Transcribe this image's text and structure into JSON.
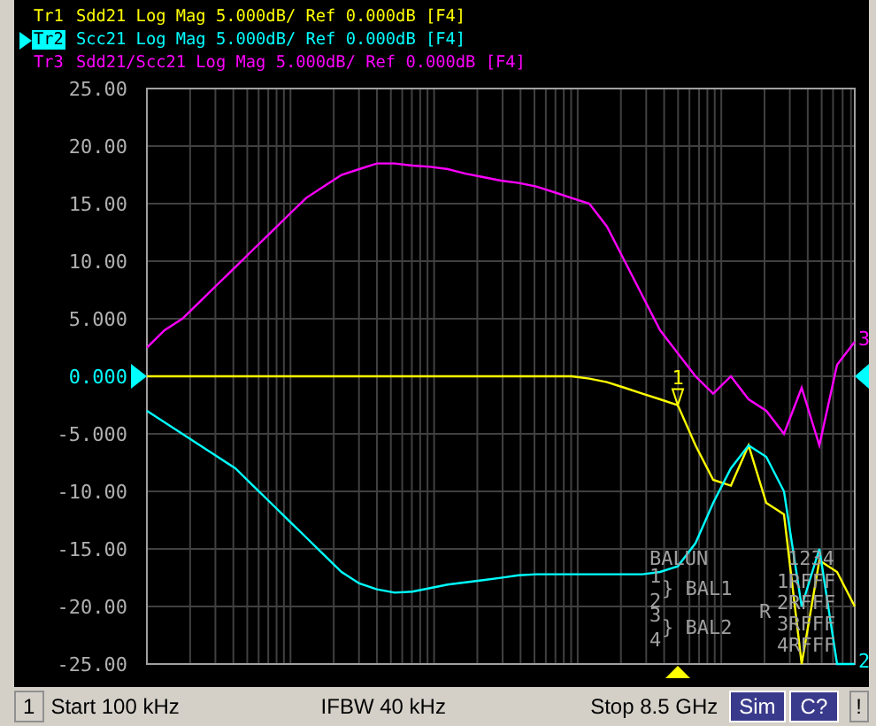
{
  "traces": [
    {
      "text": "Sdd21 Log Mag 5.000dB/ Ref 0.000dB [F4]",
      "selected": false
    },
    {
      "text": "Scc21 Log Mag 5.000dB/ Ref 0.000dB [F4]",
      "selected": true
    },
    {
      "text": "Sdd21/Scc21 Log Mag 5.000dB/ Ref 0.000dB [F4]",
      "selected": false
    }
  ],
  "chart_data": {
    "type": "line",
    "ylim": [
      -25,
      25
    ],
    "categories": [
      null,
      null,
      null,
      null,
      null,
      null,
      null,
      null,
      null,
      null,
      null,
      null,
      null,
      null,
      null,
      null,
      null,
      null,
      null,
      null,
      null,
      null,
      null,
      null,
      null,
      null,
      null,
      null,
      null,
      null,
      null,
      null,
      null,
      null,
      null,
      null,
      null,
      null,
      null,
      null,
      null
    ],
    "yticks": [
      {
        "value": 25,
        "label": "25.00"
      },
      {
        "value": 20,
        "label": "20.00"
      },
      {
        "value": 15,
        "label": "15.00"
      },
      {
        "value": 10,
        "label": "10.00"
      },
      {
        "value": 5,
        "label": "5.000"
      },
      {
        "value": 0,
        "label": "0.000"
      },
      {
        "value": -5,
        "label": "-5.000"
      },
      {
        "value": -10,
        "label": "-10.00"
      },
      {
        "value": -15,
        "label": "-15.00"
      },
      {
        "value": -20,
        "label": "-20.00"
      },
      {
        "value": -25,
        "label": "-25.00"
      }
    ],
    "series": [
      {
        "name": "Tr1",
        "color": "#ffff00",
        "values": [
          0,
          0,
          0,
          0,
          0,
          0,
          0,
          0,
          0,
          0,
          0,
          0,
          0,
          0,
          0,
          0,
          0,
          0,
          0,
          0,
          0,
          0,
          0,
          0,
          0,
          -0.2,
          -0.5,
          -1,
          -1.5,
          -2,
          -2.5,
          -6,
          -9,
          -9.5,
          -6,
          -11,
          -12,
          -25,
          -16,
          -17,
          -20
        ]
      },
      {
        "name": "Tr2",
        "color": "#00ffff",
        "values": [
          -3,
          -4,
          -5,
          -6,
          -7,
          -8,
          -9.5,
          -11,
          -12.5,
          -14,
          -15.5,
          -17,
          -18,
          -18.5,
          -18.8,
          -18.7,
          -18.4,
          -18.1,
          -17.9,
          -17.7,
          -17.5,
          -17.3,
          -17.2,
          -17.2,
          -17.2,
          -17.2,
          -17.2,
          -17.2,
          -17.2,
          -17,
          -16.5,
          -14.5,
          -11,
          -8,
          -6,
          -7,
          -10,
          -20,
          -15,
          -25,
          -25
        ]
      },
      {
        "name": "Tr3",
        "color": "#ff00ff",
        "values": [
          2.5,
          4,
          5,
          6.5,
          8,
          9.5,
          11,
          12.5,
          14,
          15.5,
          16.5,
          17.5,
          18,
          18.5,
          18.5,
          18.3,
          18.2,
          18,
          17.6,
          17.3,
          17,
          16.8,
          16.5,
          16,
          15.5,
          15,
          13,
          10,
          7,
          4,
          2,
          0,
          -1.5,
          0,
          -2,
          -3,
          -5,
          -1,
          -6,
          1,
          3
        ]
      }
    ],
    "grid": true
  },
  "markers": [
    {
      "label": "1",
      "color": "#ffff00"
    },
    {
      "label": "3",
      "color": "#ff00ff"
    },
    {
      "label": "2",
      "color": "#00ffff"
    }
  ],
  "balun": {
    "title": "BALUN",
    "ports": [
      "1",
      "2",
      "3",
      "4"
    ],
    "groups": [
      "} BAL1",
      "} BAL2"
    ],
    "matrix_header": "1234",
    "matrix_rows": [
      "1RFFF",
      "2RFFF",
      "3RFFF",
      "4RFFF"
    ],
    "flag": "R"
  },
  "status_bar": [
    {
      "kind": "channel",
      "text": "1"
    },
    {
      "kind": "text",
      "text": "Start 100 kHz"
    },
    {
      "kind": "text",
      "text": "IFBW 40 kHz"
    },
    {
      "kind": "text",
      "text": "Stop 8.5 GHz"
    },
    {
      "kind": "badge",
      "text": "Sim"
    },
    {
      "kind": "badge",
      "text": "C?"
    },
    {
      "kind": "box",
      "text": "!"
    }
  ]
}
